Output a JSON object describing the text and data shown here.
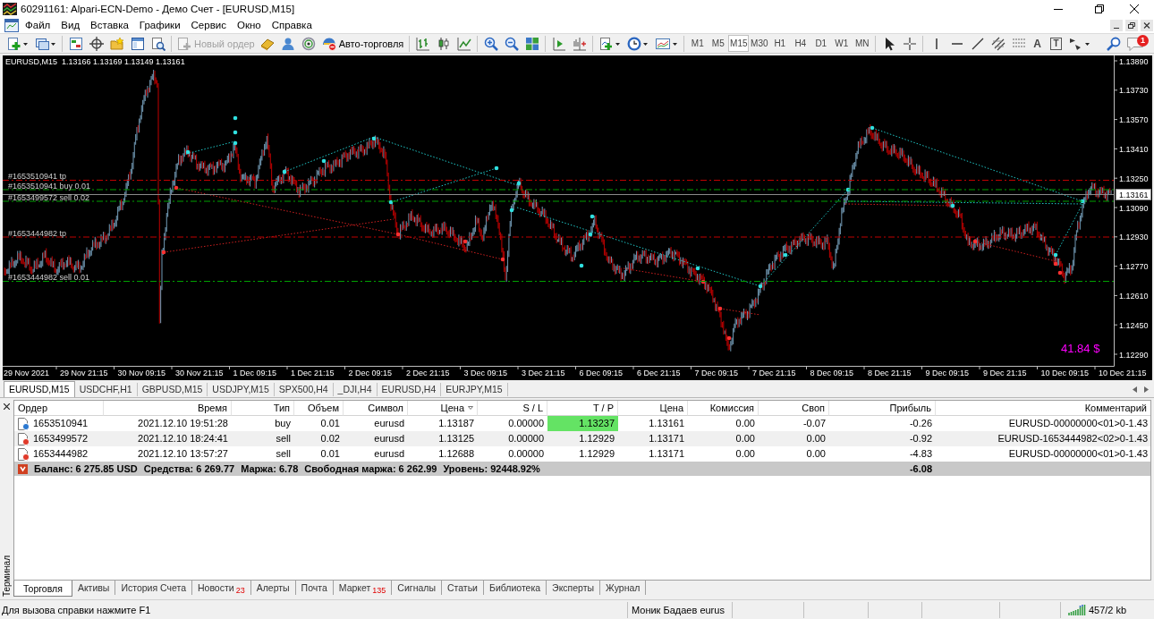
{
  "window": {
    "title": "60291161: Alpari-ECN-Demo - Демо Счет - [EURUSD,M15]"
  },
  "menu": [
    "Файл",
    "Вид",
    "Вставка",
    "Графики",
    "Сервис",
    "Окно",
    "Справка"
  ],
  "toolbar": {
    "new_order": {
      "label": "Новый ордер",
      "disabled": true
    },
    "auto_trading": {
      "label": "Авто-торговля"
    },
    "timeframes": [
      {
        "label": "M1",
        "selected": false
      },
      {
        "label": "M5",
        "selected": false
      },
      {
        "label": "M15",
        "selected": true
      },
      {
        "label": "M30",
        "selected": false
      },
      {
        "label": "H1",
        "selected": false
      },
      {
        "label": "H4",
        "selected": false
      },
      {
        "label": "D1",
        "selected": false
      },
      {
        "label": "W1",
        "selected": false
      },
      {
        "label": "MN",
        "selected": false
      }
    ],
    "text_tool": "A",
    "label_tool": "T",
    "notifications": "1"
  },
  "chart": {
    "symbol": "EURUSD,M15",
    "ohlc": "1.13166 1.13169 1.13149 1.13161",
    "order_lines": [
      {
        "label": "#1653510941 tp",
        "kind": "take_profit"
      },
      {
        "label": "#1653510941 buy 0.01",
        "kind": "position"
      },
      {
        "label": "#1653499572 sell 0.02",
        "kind": "position"
      },
      {
        "label": "#1653444982 tp",
        "kind": "take_profit"
      },
      {
        "label": "#1653444982 sell 0.01",
        "kind": "position"
      }
    ],
    "price_scale": [
      "1.13890",
      "1.13730",
      "1.13570",
      "1.13410",
      "1.13250",
      "1.13090",
      "1.12930",
      "1.12770",
      "1.12610",
      "1.12450",
      "1.12290"
    ],
    "current_price": "1.13161",
    "time_scale": [
      "29 Nov 2021",
      "29 Nov 21:15",
      "30 Nov 09:15",
      "30 Nov 21:15",
      "1 Dec 09:15",
      "1 Dec 21:15",
      "2 Dec 09:15",
      "2 Dec 21:15",
      "3 Dec 09:15",
      "3 Dec 21:15",
      "6 Dec 09:15",
      "6 Dec 21:15",
      "7 Dec 09:15",
      "7 Dec 21:15",
      "8 Dec 09:15",
      "8 Dec 21:15",
      "9 Dec 09:15",
      "9 Dec 21:15",
      "10 Dec 09:15",
      "10 Dec 21:15"
    ],
    "profit_label": "41.84 $"
  },
  "chart_tabs": [
    {
      "label": "EURUSD,M15",
      "selected": true
    },
    {
      "label": "USDCHF,H1",
      "selected": false
    },
    {
      "label": "GBPUSD,M15",
      "selected": false
    },
    {
      "label": "USDJPY,M15",
      "selected": false
    },
    {
      "label": "SPX500,H4",
      "selected": false
    },
    {
      "label": "_DJI,H4",
      "selected": false
    },
    {
      "label": "EURUSD,H4",
      "selected": false
    },
    {
      "label": "EURJPY,M15",
      "selected": false
    }
  ],
  "terminal": {
    "title": "Терминал",
    "columns": [
      {
        "label": "Ордер",
        "sorted": false
      },
      {
        "label": "Время",
        "sorted": false
      },
      {
        "label": "Тип",
        "sorted": false
      },
      {
        "label": "Объем",
        "sorted": false
      },
      {
        "label": "Символ",
        "sorted": false
      },
      {
        "label": "Цена",
        "sorted": true
      },
      {
        "label": "S / L",
        "sorted": false
      },
      {
        "label": "T / P",
        "sorted": false
      },
      {
        "label": "Цена",
        "sorted": false
      },
      {
        "label": "Комиссия",
        "sorted": false
      },
      {
        "label": "Своп",
        "sorted": false
      },
      {
        "label": "Прибыль",
        "sorted": false
      },
      {
        "label": "Комментарий",
        "sorted": false
      }
    ],
    "orders": [
      {
        "kind": "buy",
        "order": "1653510941",
        "time": "2021.12.10 19:51:28",
        "type": "buy",
        "volume": "0.01",
        "symbol": "eurusd",
        "price": "1.13187",
        "sl": "0.00000",
        "tp": "1.13237",
        "tp_highlight": true,
        "current_price": "1.13161",
        "commission": "0.00",
        "swap": "-0.07",
        "profit": "-0.26",
        "comment": "EURUSD-00000000<01>0-1.43"
      },
      {
        "kind": "sell",
        "order": "1653499572",
        "time": "2021.12.10 18:24:41",
        "type": "sell",
        "volume": "0.02",
        "symbol": "eurusd",
        "price": "1.13125",
        "sl": "0.00000",
        "tp": "1.12929",
        "tp_highlight": false,
        "current_price": "1.13171",
        "commission": "0.00",
        "swap": "0.00",
        "profit": "-0.92",
        "comment": "EURUSD-1653444982<02>0-1.43"
      },
      {
        "kind": "sell",
        "order": "1653444982",
        "time": "2021.12.10 13:57:27",
        "type": "sell",
        "volume": "0.01",
        "symbol": "eurusd",
        "price": "1.12688",
        "sl": "0.00000",
        "tp": "1.12929",
        "tp_highlight": false,
        "current_price": "1.13171",
        "commission": "0.00",
        "swap": "0.00",
        "profit": "-4.83",
        "comment": "EURUSD-00000000<01>0-1.43"
      }
    ],
    "summary": {
      "items": [
        "Баланс: 6 275.85 USD",
        "Средства: 6 269.77",
        "Маржа: 6.78",
        "Свободная маржа: 6 262.99",
        "Уровень: 92448.92%"
      ],
      "profit": "-6.08"
    },
    "tabs": [
      {
        "label": "Торговля",
        "selected": true
      },
      {
        "label": "Активы",
        "selected": false
      },
      {
        "label": "История Счета",
        "selected": false
      },
      {
        "label": "Новости",
        "badge": "23",
        "selected": false
      },
      {
        "label": "Алерты",
        "selected": false
      },
      {
        "label": "Почта",
        "selected": false
      },
      {
        "label": "Маркет",
        "badge": "135",
        "selected": false
      },
      {
        "label": "Сигналы",
        "selected": false
      },
      {
        "label": "Статьи",
        "selected": false
      },
      {
        "label": "Библиотека",
        "selected": false
      },
      {
        "label": "Эксперты",
        "selected": false
      },
      {
        "label": "Журнал",
        "selected": false
      }
    ]
  },
  "status_bar": {
    "help": "Для вызова справки нажмите F1",
    "account": "Моник Бадаев eurus",
    "traffic": "457/2 kb"
  }
}
